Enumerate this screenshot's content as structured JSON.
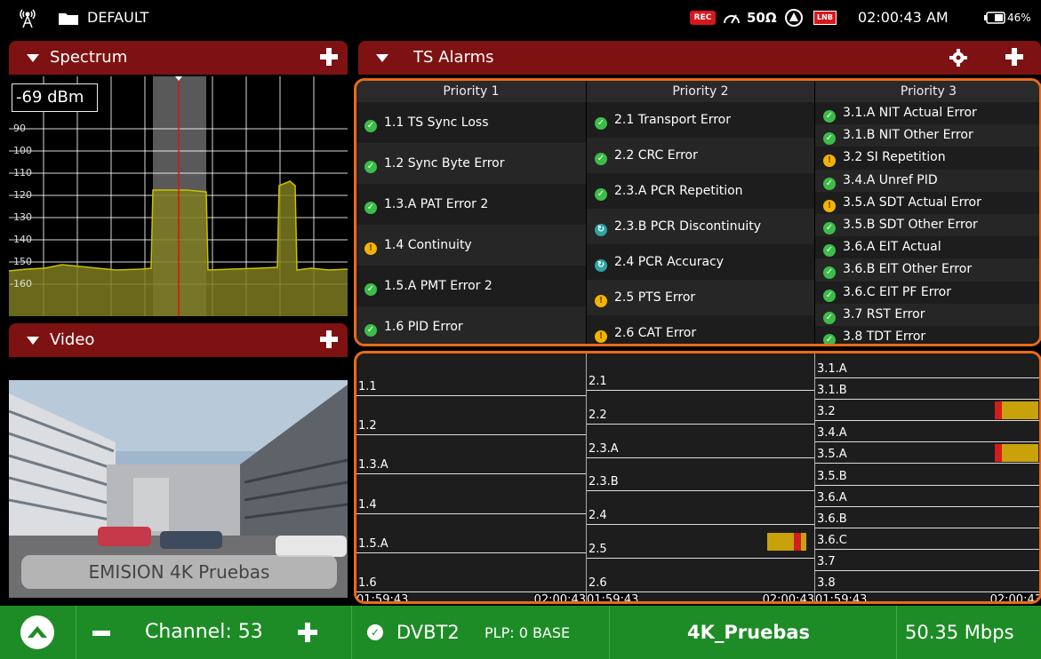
{
  "status_bar": {
    "profile": "DEFAULT",
    "rec_label": "REC",
    "impedance": "50Ω",
    "lnb_label": "LNB",
    "time": "02:00:43 AM",
    "battery": "46%",
    "icons": [
      "antenna-icon",
      "folder-icon",
      "rec-badge",
      "gauge-icon",
      "impedance-label",
      "alarm-icon",
      "lnb-badge",
      "battery-icon"
    ]
  },
  "spectrum": {
    "title": "Spectrum",
    "level": "-69 dBm",
    "ticks": [
      "-90",
      "-100",
      "-110",
      "-120",
      "-130",
      "-140",
      "-150",
      "-160"
    ],
    "colors": {
      "trace": "#c8c300",
      "fill": "#7d7a1e",
      "marker": "#e01010",
      "grid": "#ffffff"
    }
  },
  "video": {
    "title": "Video",
    "service_label": "EMISION 4K Pruebas"
  },
  "ts_alarms": {
    "title": "TS Alarms",
    "columns": [
      {
        "header": "Priority 1",
        "items": [
          {
            "label": "1.1 TS Sync Loss",
            "status": "ok"
          },
          {
            "label": "1.2 Sync Byte Error",
            "status": "ok"
          },
          {
            "label": "1.3.A PAT Error 2",
            "status": "ok"
          },
          {
            "label": "1.4 Continuity",
            "status": "warn"
          },
          {
            "label": "1.5.A PMT Error 2",
            "status": "ok"
          },
          {
            "label": "1.6 PID Error",
            "status": "ok"
          }
        ]
      },
      {
        "header": "Priority 2",
        "items": [
          {
            "label": "2.1 Transport Error",
            "status": "ok"
          },
          {
            "label": "2.2 CRC Error",
            "status": "ok"
          },
          {
            "label": "2.3.A PCR Repetition",
            "status": "ok"
          },
          {
            "label": "2.3.B PCR Discontinuity",
            "status": "info"
          },
          {
            "label": "2.4 PCR Accuracy",
            "status": "info"
          },
          {
            "label": "2.5 PTS Error",
            "status": "warn"
          },
          {
            "label": "2.6 CAT Error",
            "status": "warn"
          }
        ]
      },
      {
        "header": "Priority 3",
        "items": [
          {
            "label": "3.1.A NIT Actual Error",
            "status": "ok"
          },
          {
            "label": "3.1.B NIT Other Error",
            "status": "ok"
          },
          {
            "label": "3.2 SI Repetition",
            "status": "warn"
          },
          {
            "label": "3.4.A Unref PID",
            "status": "ok"
          },
          {
            "label": "3.5.A SDT Actual Error",
            "status": "warn"
          },
          {
            "label": "3.5.B SDT Other Error",
            "status": "ok"
          },
          {
            "label": "3.6.A EIT Actual",
            "status": "ok"
          },
          {
            "label": "3.6.B EIT Other Error",
            "status": "ok"
          },
          {
            "label": "3.6.C EIT PF Error",
            "status": "ok"
          },
          {
            "label": "3.7 RST Error",
            "status": "ok"
          },
          {
            "label": "3.8 TDT Error",
            "status": "ok"
          }
        ]
      }
    ]
  },
  "history": {
    "start_time": "01:59:43",
    "end_time": "02:00:43",
    "columns": [
      {
        "rows": [
          "1.1",
          "1.2",
          "1.3.A",
          "1.4",
          "1.5.A",
          "1.6"
        ],
        "events": []
      },
      {
        "rows": [
          "2.1",
          "2.2",
          "2.3.A",
          "2.3.B",
          "2.4",
          "2.5",
          "2.6"
        ],
        "events": [
          {
            "row": 5,
            "start": 0.79,
            "end": 0.96,
            "severity": "warn"
          }
        ]
      },
      {
        "rows": [
          "3.1.A",
          "3.1.B",
          "3.2",
          "3.4.A",
          "3.5.A",
          "3.5.B",
          "3.6.A",
          "3.6.B",
          "3.6.C",
          "3.7",
          "3.8"
        ],
        "events": [
          {
            "row": 2,
            "start": 0.79,
            "end": 0.98,
            "severity": "warn"
          },
          {
            "row": 4,
            "start": 0.79,
            "end": 0.98,
            "severity": "warn"
          }
        ]
      }
    ],
    "colors": {
      "warn": "#c9a10a",
      "error": "#d31c1c"
    }
  },
  "bottom_bar": {
    "channel_label": "Channel: 53",
    "standard": "DVBT2",
    "plp": "PLP: 0 BASE",
    "service": "4K_Pruebas",
    "bitrate": "50.35 Mbps"
  }
}
